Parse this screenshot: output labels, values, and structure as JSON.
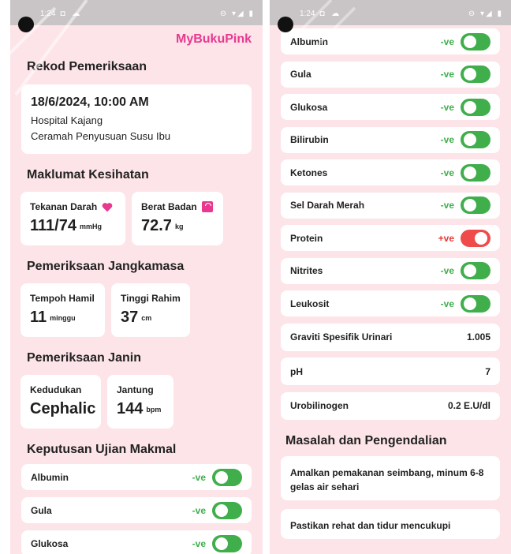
{
  "status": {
    "time": "1:24",
    "icons_left": "◘ ☁",
    "icons_right": "⊖ ▾◢ ▮"
  },
  "brand": "MyBukuPink",
  "rekod": {
    "title": "Rekod Pemeriksaan",
    "datetime": "18/6/2024, 10:00 AM",
    "hospital": "Hospital Kajang",
    "activity": "Ceramah Penyusuan Susu Ibu"
  },
  "kesihatan": {
    "title": "Maklumat Kesihatan",
    "bp_label": "Tekanan Darah",
    "bp_value": "111/74",
    "bp_unit": "mmHg",
    "weight_label": "Berat Badan",
    "weight_value": "72.7",
    "weight_unit": "kg"
  },
  "jangkamasa": {
    "title": "Pemeriksaan Jangkamasa",
    "gest_label": "Tempoh Hamil",
    "gest_value": "11",
    "gest_unit": "minggu",
    "fundal_label": "Tinggi Rahim",
    "fundal_value": "37",
    "fundal_unit": "cm"
  },
  "janin": {
    "title": "Pemeriksaan Janin",
    "pos_label": "Kedudukan",
    "pos_value": "Cephalic",
    "hr_label": "Jantung",
    "hr_value": "144",
    "hr_unit": "bpm"
  },
  "makmal": {
    "title": "Keputusan Ujian Makmal",
    "left_tests": [
      {
        "name": "Albumin",
        "result": "-ve"
      },
      {
        "name": "Gula",
        "result": "-ve"
      },
      {
        "name": "Glukosa",
        "result": "-ve"
      }
    ],
    "tests": [
      {
        "name": "Albumin",
        "result": "-ve",
        "positive": false
      },
      {
        "name": "Gula",
        "result": "-ve",
        "positive": false
      },
      {
        "name": "Glukosa",
        "result": "-ve",
        "positive": false
      },
      {
        "name": "Bilirubin",
        "result": "-ve",
        "positive": false
      },
      {
        "name": "Ketones",
        "result": "-ve",
        "positive": false
      },
      {
        "name": "Sel Darah Merah",
        "result": "-ve",
        "positive": false
      },
      {
        "name": "Protein",
        "result": "+ve",
        "positive": true
      },
      {
        "name": "Nitrites",
        "result": "-ve",
        "positive": false
      },
      {
        "name": "Leukosit",
        "result": "-ve",
        "positive": false
      }
    ],
    "values": [
      {
        "name": "Graviti Spesifik Urinari",
        "value": "1.005"
      },
      {
        "name": "pH",
        "value": "7"
      },
      {
        "name": "Urobilinogen",
        "value": "0.2 E.U/dl"
      }
    ]
  },
  "masalah": {
    "title": "Masalah dan Pengendalian",
    "notes": [
      "Amalkan pemakanan seimbang, minum 6-8 gelas air sehari",
      "Pastikan rehat dan tidur mencukupi"
    ]
  },
  "colors": {
    "brand": "#e8388f",
    "negative": "#3fae4b",
    "positive": "#ef4b4b",
    "background": "#fde4e8"
  }
}
